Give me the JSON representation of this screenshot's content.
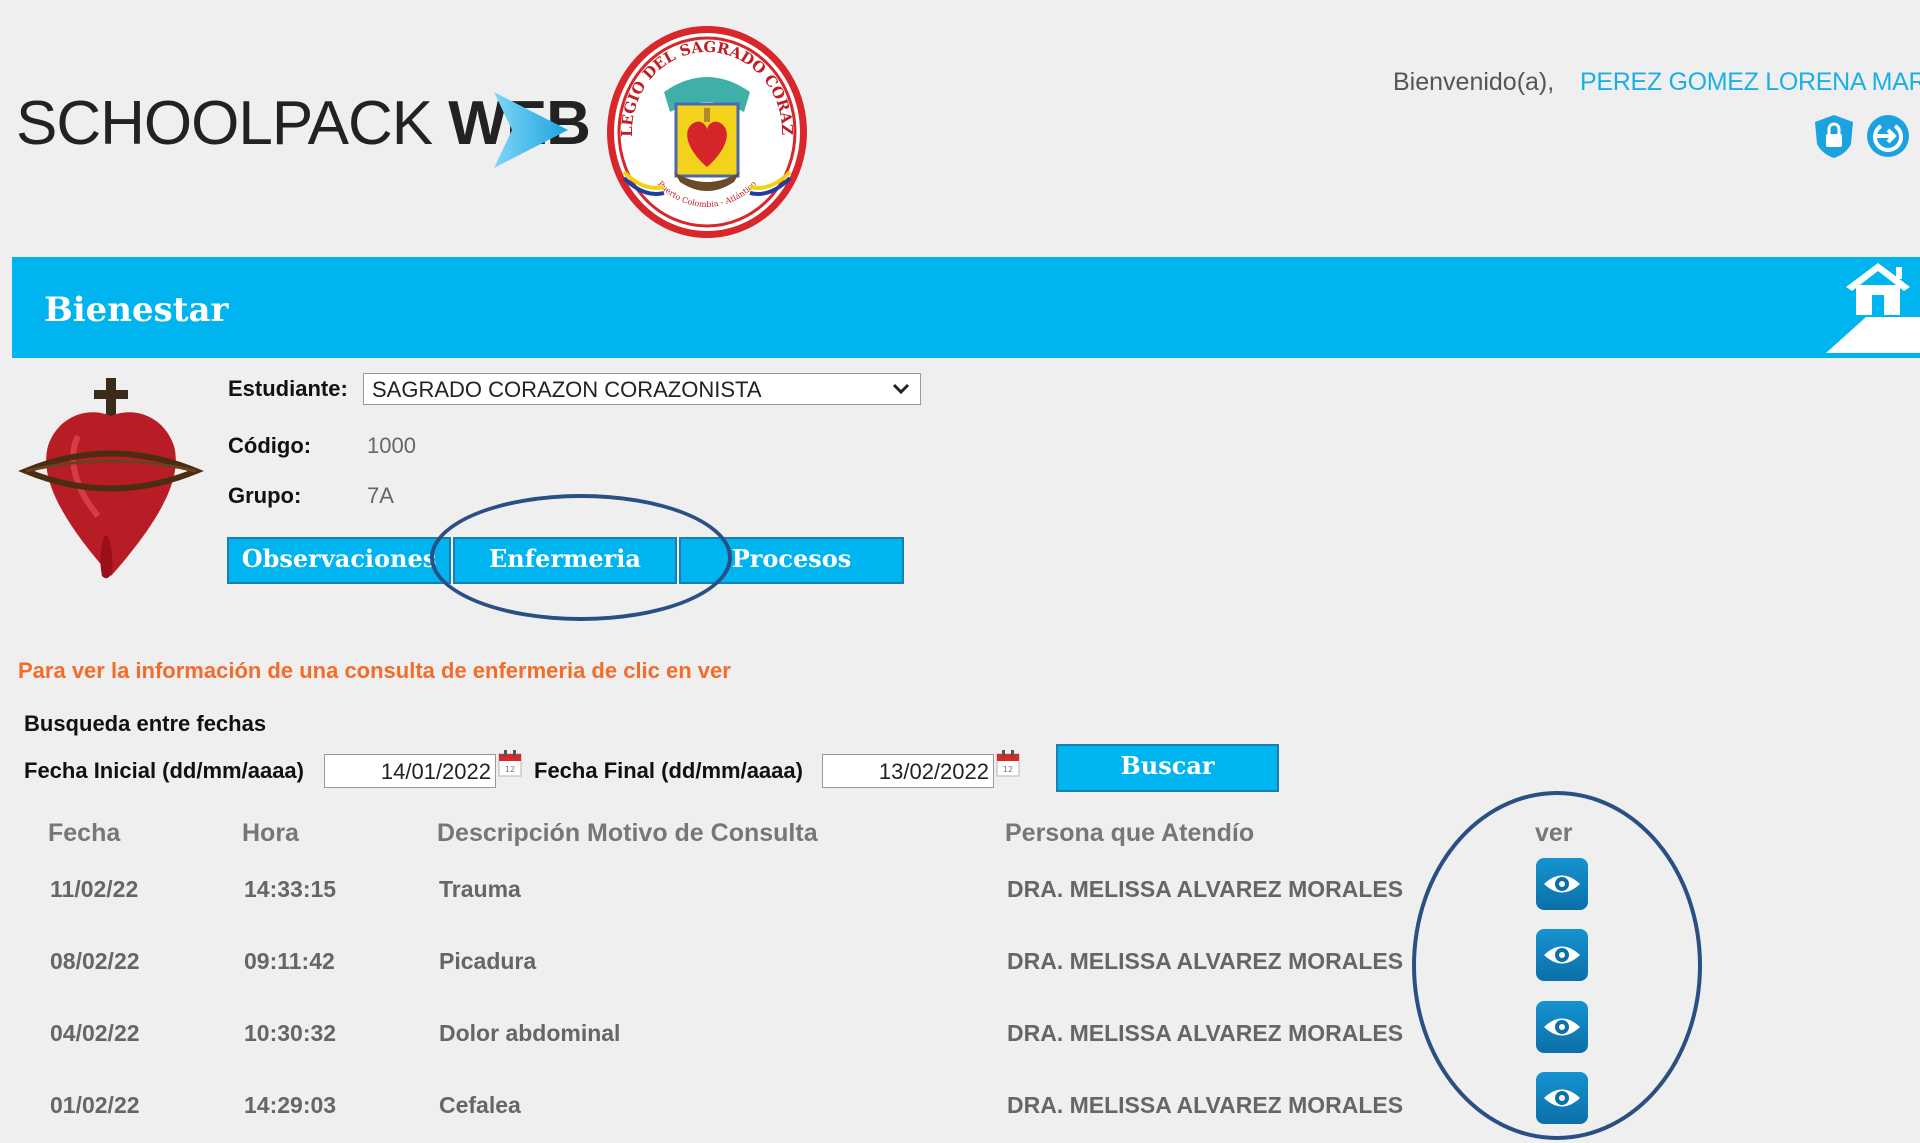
{
  "header": {
    "brand_light": "SCHOOLPACK ",
    "brand_bold": "WEB",
    "seal_top_text": "COLEGIO DEL SAGRADO CORAZON",
    "seal_bottom_text": "Puerto Colombia - Atlántico",
    "welcome": "Bienvenido(a),",
    "user_name": "PEREZ GOMEZ LORENA MARIA",
    "icons": [
      "lock-icon",
      "logout-icon"
    ]
  },
  "banner": {
    "title": "Bienestar",
    "home_icon": "home-icon"
  },
  "student": {
    "student_label": "Estudiante:",
    "student_value": "SAGRADO CORAZON CORAZONISTA",
    "code_label": "Código:",
    "code_value": "1000",
    "group_label": "Grupo:",
    "group_value": "7A"
  },
  "tabs": [
    {
      "label": "Observaciones"
    },
    {
      "label": "Enfermeria"
    },
    {
      "label": "Procesos"
    }
  ],
  "hint": "Para ver la información de una consulta de enfermeria de clic en ver",
  "search": {
    "title": "Busqueda entre fechas",
    "start_label": "Fecha Inicial (dd/mm/aaaa)",
    "start_value": "14/01/2022",
    "end_label": "Fecha Final (dd/mm/aaaa)",
    "end_value": "13/02/2022",
    "button": "Buscar"
  },
  "table": {
    "headers": [
      "Fecha",
      "Hora",
      "Descripción Motivo de Consulta",
      "Persona que Atendío",
      "ver"
    ],
    "rows": [
      {
        "fecha": "11/02/22",
        "hora": "14:33:15",
        "motivo": "Trauma",
        "persona": "DRA. MELISSA ALVAREZ MORALES"
      },
      {
        "fecha": "08/02/22",
        "hora": "09:11:42",
        "motivo": "Picadura",
        "persona": "DRA. MELISSA ALVAREZ MORALES"
      },
      {
        "fecha": "04/02/22",
        "hora": "10:30:32",
        "motivo": "Dolor abdominal",
        "persona": "DRA. MELISSA ALVAREZ MORALES"
      },
      {
        "fecha": "01/02/22",
        "hora": "14:29:03",
        "motivo": "Cefalea",
        "persona": "DRA. MELISSA ALVAREZ MORALES"
      }
    ]
  },
  "colors": {
    "accent": "#00b4ef",
    "hint": "#f26c2a",
    "user": "#1ab0e6",
    "annotation_ring": "#2a4f82"
  }
}
